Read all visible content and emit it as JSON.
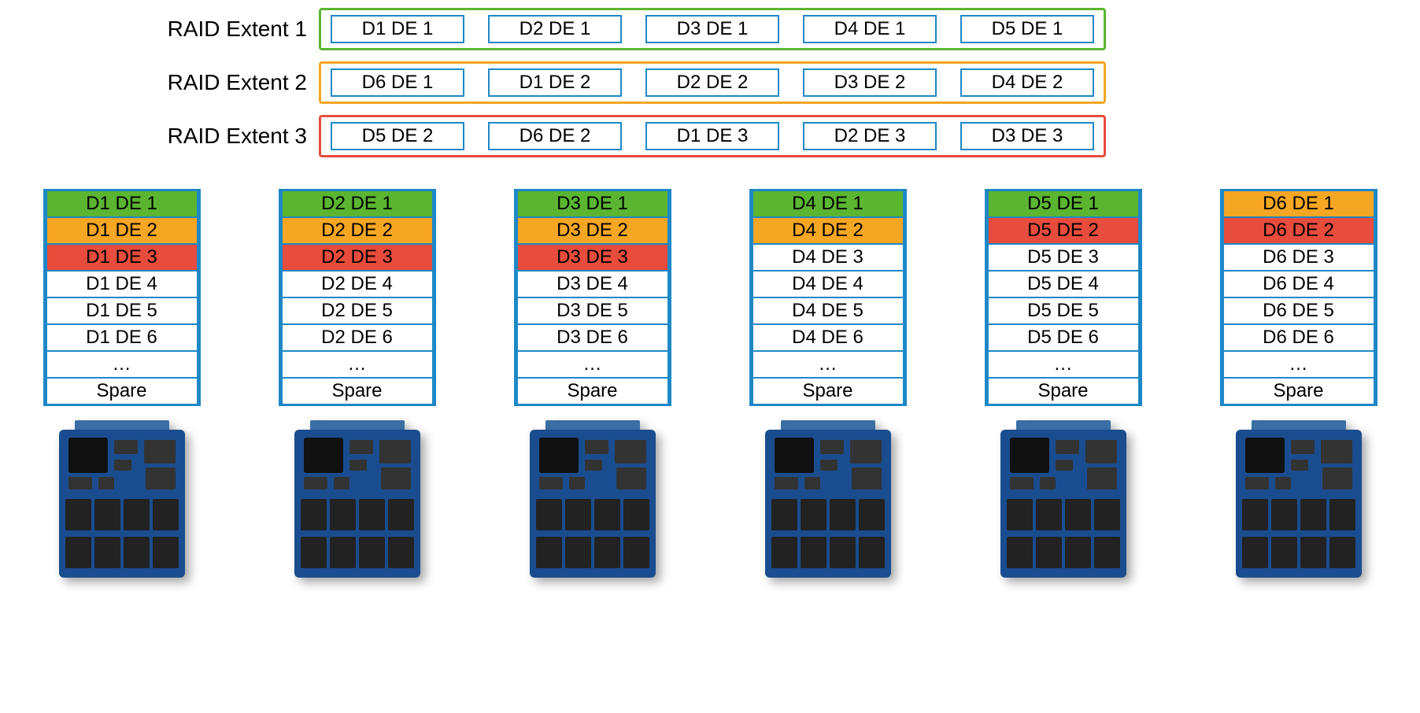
{
  "extents": [
    {
      "label": "RAID Extent 1",
      "color": "green",
      "cells": [
        "D1 DE 1",
        "D2 DE 1",
        "D3 DE 1",
        "D4 DE 1",
        "D5 DE 1"
      ]
    },
    {
      "label": "RAID Extent 2",
      "color": "orange",
      "cells": [
        "D6 DE 1",
        "D1 DE 2",
        "D2 DE 2",
        "D3 DE 2",
        "D4 DE 2"
      ]
    },
    {
      "label": "RAID Extent 3",
      "color": "red",
      "cells": [
        "D5 DE 2",
        "D6 DE 2",
        "D1 DE 3",
        "D2 DE 3",
        "D3 DE 3"
      ]
    }
  ],
  "disks": [
    {
      "slots": [
        {
          "t": "D1 DE 1",
          "c": "green"
        },
        {
          "t": "D1 DE 2",
          "c": "orange"
        },
        {
          "t": "D1 DE 3",
          "c": "red"
        },
        {
          "t": "D1 DE 4",
          "c": ""
        },
        {
          "t": "D1 DE 5",
          "c": ""
        },
        {
          "t": "D1 DE 6",
          "c": ""
        },
        {
          "t": "…",
          "c": ""
        },
        {
          "t": "Spare",
          "c": ""
        }
      ]
    },
    {
      "slots": [
        {
          "t": "D2 DE 1",
          "c": "green"
        },
        {
          "t": "D2 DE 2",
          "c": "orange"
        },
        {
          "t": "D2 DE 3",
          "c": "red"
        },
        {
          "t": "D2 DE 4",
          "c": ""
        },
        {
          "t": "D2 DE 5",
          "c": ""
        },
        {
          "t": "D2 DE 6",
          "c": ""
        },
        {
          "t": "…",
          "c": ""
        },
        {
          "t": "Spare",
          "c": ""
        }
      ]
    },
    {
      "slots": [
        {
          "t": "D3 DE 1",
          "c": "green"
        },
        {
          "t": "D3 DE 2",
          "c": "orange"
        },
        {
          "t": "D3 DE 3",
          "c": "red"
        },
        {
          "t": "D3 DE 4",
          "c": ""
        },
        {
          "t": "D3 DE 5",
          "c": ""
        },
        {
          "t": "D3 DE 6",
          "c": ""
        },
        {
          "t": "…",
          "c": ""
        },
        {
          "t": "Spare",
          "c": ""
        }
      ]
    },
    {
      "slots": [
        {
          "t": "D4 DE 1",
          "c": "green"
        },
        {
          "t": "D4 DE 2",
          "c": "orange"
        },
        {
          "t": "D4 DE 3",
          "c": ""
        },
        {
          "t": "D4 DE 4",
          "c": ""
        },
        {
          "t": "D4 DE 5",
          "c": ""
        },
        {
          "t": "D4 DE 6",
          "c": ""
        },
        {
          "t": "…",
          "c": ""
        },
        {
          "t": "Spare",
          "c": ""
        }
      ]
    },
    {
      "slots": [
        {
          "t": "D5 DE 1",
          "c": "green"
        },
        {
          "t": "D5 DE 2",
          "c": "red"
        },
        {
          "t": "D5 DE 3",
          "c": ""
        },
        {
          "t": "D5 DE 4",
          "c": ""
        },
        {
          "t": "D5 DE 5",
          "c": ""
        },
        {
          "t": "D5 DE 6",
          "c": ""
        },
        {
          "t": "…",
          "c": ""
        },
        {
          "t": "Spare",
          "c": ""
        }
      ]
    },
    {
      "slots": [
        {
          "t": "D6 DE 1",
          "c": "orange"
        },
        {
          "t": "D6 DE 2",
          "c": "red"
        },
        {
          "t": "D6 DE 3",
          "c": ""
        },
        {
          "t": "D6 DE 4",
          "c": ""
        },
        {
          "t": "D6 DE 5",
          "c": ""
        },
        {
          "t": "D6 DE 6",
          "c": ""
        },
        {
          "t": "…",
          "c": ""
        },
        {
          "t": "Spare",
          "c": ""
        }
      ]
    }
  ]
}
